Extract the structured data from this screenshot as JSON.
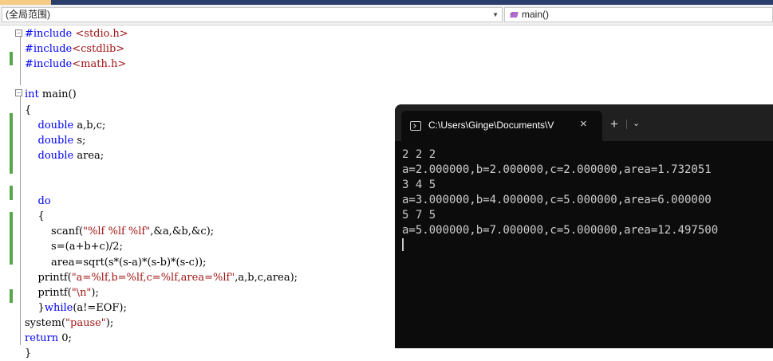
{
  "nav": {
    "scope": "(全局范围)",
    "member": "main()"
  },
  "code_lines": [
    "#include <stdio.h>",
    "#include<cstdlib>",
    "#include<math.h>",
    "",
    "int main()",
    "{",
    "    double a,b,c;",
    "    double s;",
    "    double area;",
    "",
    "",
    "    do",
    "    {",
    "        scanf(\"%lf %lf %lf\",&a,&b,&c);",
    "        s=(a+b+c)/2;",
    "        area=sqrt(s*(s-a)*(s-b)*(s-c));",
    "    printf(\"a=%lf,b=%lf,c=%lf,area=%lf\",a,b,c,area);",
    "    printf(\"\\n\");",
    "    }while(a!=EOF);",
    "system(\"pause\");",
    "return 0;",
    "}"
  ],
  "terminal": {
    "tab_title": "C:\\Users\\Ginge\\Documents\\V",
    "close_glyph": "×",
    "new_tab_glyph": "+",
    "dropdown_glyph": "⌄",
    "lines": [
      "2 2 2",
      "a=2.000000,b=2.000000,c=2.000000,area=1.732051",
      "3 4 5",
      "a=3.000000,b=4.000000,c=5.000000,area=6.000000",
      "5 7 5",
      "a=5.000000,b=7.000000,c=5.000000,area=12.497500"
    ]
  },
  "colors": {
    "keyword": "#0000ff",
    "string": "#a31515",
    "change_marker": "#57a64a",
    "terminal_bg": "#0c0c0c",
    "terminal_text": "#cccccc"
  }
}
